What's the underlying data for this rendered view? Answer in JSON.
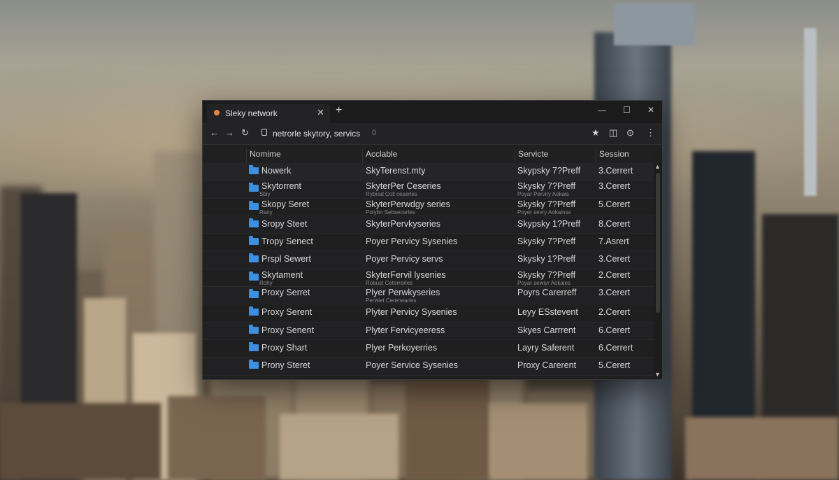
{
  "browser": {
    "tab_title": "Sleky network",
    "address": "netrorle skytory, servics",
    "address_suffix": "0"
  },
  "icons": {
    "back": "arrow-left-icon",
    "forward": "arrow-right-icon",
    "reload": "reload-icon",
    "bookmark": "star-icon",
    "extension": "puzzle-icon",
    "download": "download-icon",
    "menu": "kebab-menu-icon"
  },
  "colors": {
    "folder": "#3d8fe0",
    "tab_indicator": "#e48a3c"
  },
  "table": {
    "columns": [
      "Nomime",
      "Acclable",
      "Servicte",
      "Session"
    ],
    "rows": [
      {
        "name": "Nowerk",
        "name_sub": "",
        "avail": "SkyTerenst.mty",
        "avail_sub": "",
        "service": "Skypsky 7?Preff",
        "service_sub": "",
        "session": "3.Cerrert"
      },
      {
        "name": "Skytorrent",
        "name_sub": "Sbiy",
        "avail": "SkyterPer Ceseries",
        "avail_sub": "Rybrad Coll ceserles",
        "service": "Skysky 7?Preff",
        "service_sub": "Poyar Perviry Aokais",
        "session": "3.Cerert"
      },
      {
        "name": "Skopy Seret",
        "name_sub": "Rany",
        "avail": "SkyterPerwdgy series",
        "avail_sub": "Polybn Sebsecarles",
        "service": "Skysky 7?Preff",
        "service_sub": "Poyer sevry Aokainss",
        "session": "5.Cerert"
      },
      {
        "name": "Sropy Steet",
        "name_sub": "",
        "avail": "SkyterPervkyseries",
        "avail_sub": "",
        "service": "Skypsky 1?Preff",
        "service_sub": "",
        "session": "8.Cerert"
      },
      {
        "name": "Tropy Senect",
        "name_sub": "",
        "avail": "Poyer Pervicy Sysenies",
        "avail_sub": "",
        "service": "Skysky 7?Preff",
        "service_sub": "",
        "session": "7.Asrert"
      },
      {
        "name": "Prspl Sewert",
        "name_sub": "",
        "avail": "Poyer Pervicy servs",
        "avail_sub": "",
        "service": "Skysky 1?Preff",
        "service_sub": "",
        "session": "3.Cerert"
      },
      {
        "name": "Skytament",
        "name_sub": "Rohy",
        "avail": "SkyterFervil lysenies",
        "avail_sub": "Robust Ceterrerles",
        "service": "Skysky 7?Preff",
        "service_sub": "Poyar sewiyr Aokaies",
        "session": "2.Cerert"
      },
      {
        "name": "Proxy Serret",
        "name_sub": "",
        "avail": "Plyer Perwkyseries",
        "avail_sub": "Perwiet Cerenearles",
        "service": "Poyrs Carerreff",
        "service_sub": "",
        "session": "3.Cerert"
      },
      {
        "name": "Proxy Serent",
        "name_sub": "",
        "avail": "Plyter Pervicy Sysenies",
        "avail_sub": "",
        "service": "Leyy ESstevent",
        "service_sub": "",
        "session": "2.Cerert"
      },
      {
        "name": "Proxy Senent",
        "name_sub": "",
        "avail": "Plyter Fervicyeeress",
        "avail_sub": "",
        "service": "Skyes Carrrent",
        "service_sub": "",
        "session": "6.Cerert"
      },
      {
        "name": "Proxy Shart",
        "name_sub": "",
        "avail": "Plyer Perkoyerries",
        "avail_sub": "",
        "service": "Layry Saferent",
        "service_sub": "",
        "session": "6.Cerrert"
      },
      {
        "name": "Prony Steret",
        "name_sub": "",
        "avail": "Poyer Service Sysenies",
        "avail_sub": "",
        "service": "Proxy Carerent",
        "service_sub": "",
        "session": "5.Cerert"
      }
    ]
  }
}
